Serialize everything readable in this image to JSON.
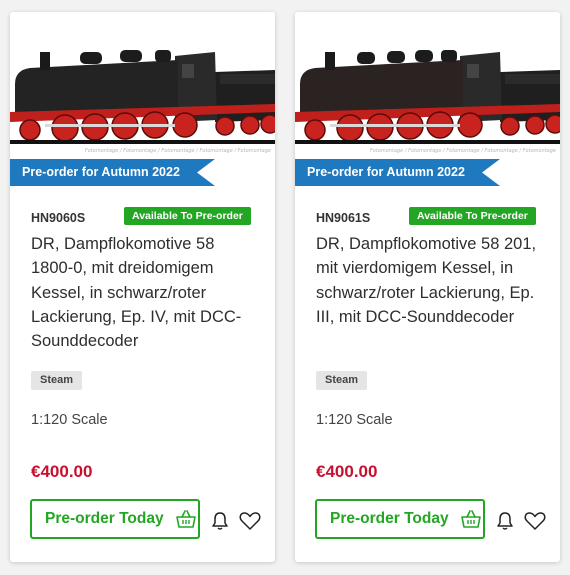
{
  "colors": {
    "accent_green": "#23a623",
    "price_red": "#c8102e",
    "banner_blue": "#1f79be"
  },
  "products": [
    {
      "photo_credit": "Fotomontage / Fotomontage / Fotomontage / Fotomontage / Fotomontage",
      "banner": "Pre-order for Autumn 2022",
      "sku": "HN9060S",
      "availability": "Available To Pre-order",
      "title": "DR, Dampflokomotive 58 1800-0, mit dreidomigem Kessel, in schwarz/roter Lackierung, Ep. IV, mit DCC-Sounddecoder",
      "tag": "Steam",
      "scale": "1:120 Scale",
      "price": "€400.00",
      "preorder_label": "Pre-order Today",
      "icons": {
        "basket": "basket-icon",
        "bell": "bell-icon",
        "heart": "heart-icon"
      }
    },
    {
      "photo_credit": "Fotomontage / Fotomontage / Fotomontage / Fotomontage / Fotomontage",
      "banner": "Pre-order for Autumn 2022",
      "sku": "HN9061S",
      "availability": "Available To Pre-order",
      "title": "DR, Dampflokomotive 58 201, mit vierdomigem Kessel, in schwarz/roter Lackierung, Ep. III, mit DCC-Sounddecoder",
      "tag": "Steam",
      "scale": "1:120 Scale",
      "price": "€400.00",
      "preorder_label": "Pre-order Today",
      "icons": {
        "basket": "basket-icon",
        "bell": "bell-icon",
        "heart": "heart-icon"
      }
    }
  ]
}
